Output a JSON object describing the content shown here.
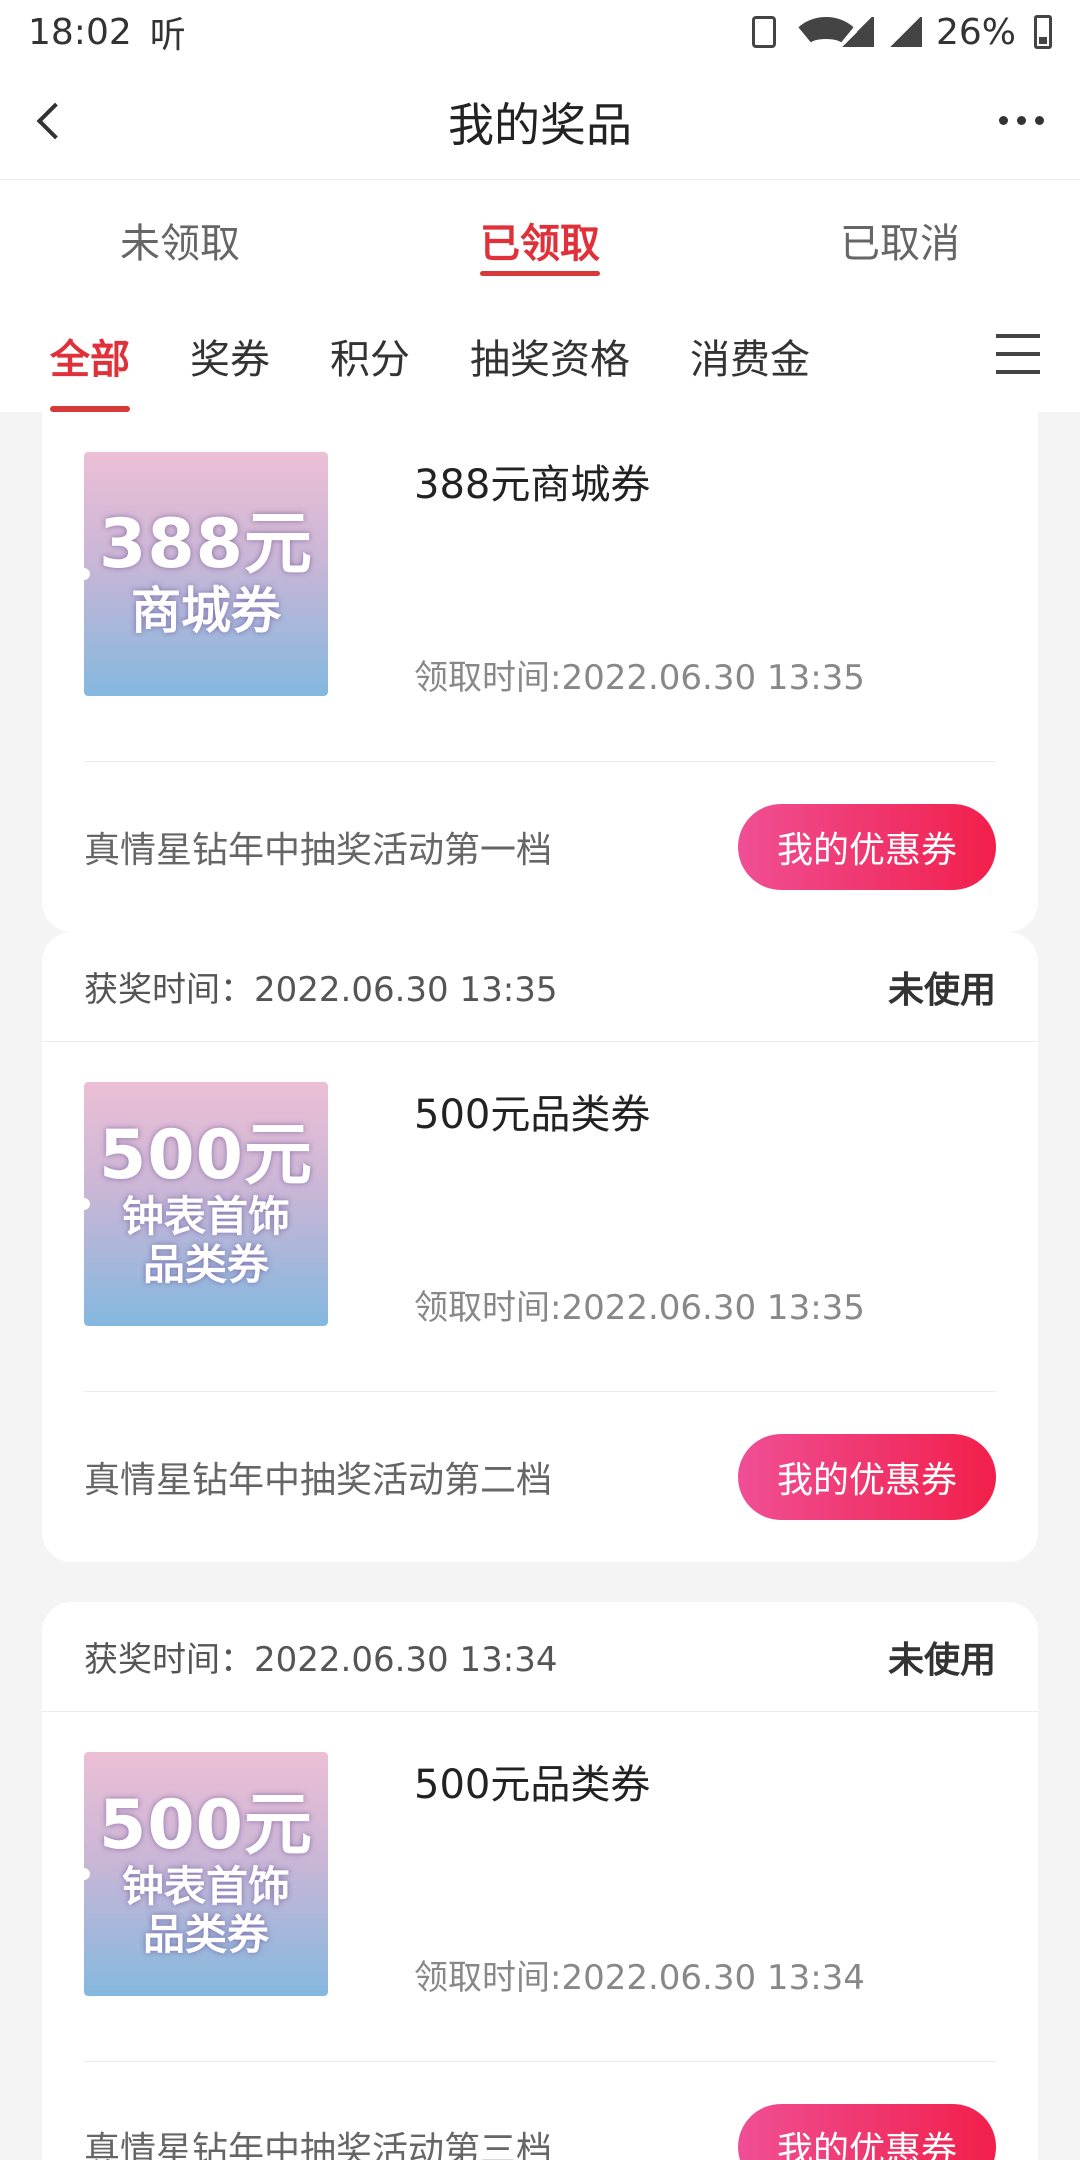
{
  "status_bar": {
    "time": "18:02",
    "listen_label": "听",
    "battery": "26%"
  },
  "nav": {
    "title": "我的奖品"
  },
  "tabs": [
    {
      "label": "未领取",
      "active": false
    },
    {
      "label": "已领取",
      "active": true
    },
    {
      "label": "已取消",
      "active": false
    }
  ],
  "subtabs": [
    {
      "label": "全部",
      "active": true
    },
    {
      "label": "奖券",
      "active": false
    },
    {
      "label": "积分",
      "active": false
    },
    {
      "label": "抽奖资格",
      "active": false
    },
    {
      "label": "消费金",
      "active": false
    }
  ],
  "cards": [
    {
      "win_time": "",
      "status": "",
      "coupon_amount": "388元",
      "coupon_line1": "商城券",
      "coupon_line2": "",
      "prize_name": "388元商城券",
      "claim_time": "领取时间:2022.06.30 13:35",
      "activity": "真情星钻年中抽奖活动第一档",
      "button": "我的优惠券"
    },
    {
      "win_time": "获奖时间：2022.06.30 13:35",
      "status": "未使用",
      "coupon_amount": "500元",
      "coupon_line1": "钟表首饰",
      "coupon_line2": "品类券",
      "prize_name": "500元品类券",
      "claim_time": "领取时间:2022.06.30 13:35",
      "activity": "真情星钻年中抽奖活动第二档",
      "button": "我的优惠券"
    },
    {
      "win_time": "获奖时间：2022.06.30 13:34",
      "status": "未使用",
      "coupon_amount": "500元",
      "coupon_line1": "钟表首饰",
      "coupon_line2": "品类券",
      "prize_name": "500元品类券",
      "claim_time": "领取时间:2022.06.30 13:34",
      "activity": "真情星钻年中抽奖活动第三档",
      "button": "我的优惠券"
    }
  ],
  "colors": {
    "accent": "#e0303a",
    "button_start": "#f04f95",
    "button_end": "#f11f4a"
  }
}
